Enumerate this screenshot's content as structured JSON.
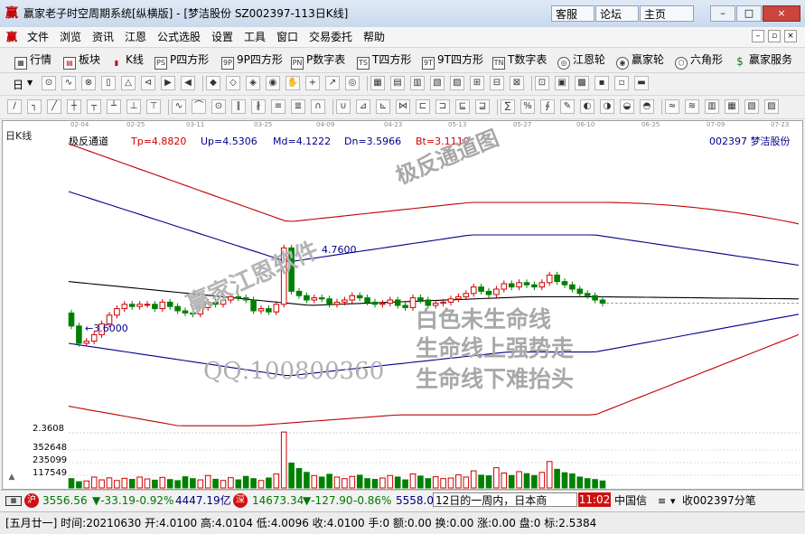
{
  "window": {
    "app_icon": "赢",
    "title": "赢家老子时空周期系统[纵横版] - [梦洁股份   SZ002397-113日K线]",
    "links": [
      "客服",
      "论坛",
      "主页"
    ],
    "controls": [
      "–",
      "□",
      "×"
    ]
  },
  "menu": {
    "logo": "赢",
    "items": [
      "文件",
      "浏览",
      "资讯",
      "江恩",
      "公式选股",
      "设置",
      "工具",
      "窗口",
      "交易委托",
      "帮助"
    ],
    "mdi_buttons": [
      "–",
      "▫",
      "×"
    ]
  },
  "functions": {
    "items": [
      {
        "label": "行情",
        "icon": "grid-icon"
      },
      {
        "label": "板块",
        "icon": "plate-icon"
      },
      {
        "label": "K线",
        "icon": "kline-icon"
      },
      {
        "label": "P四方形",
        "icon": "ps-icon",
        "badge": "PS"
      },
      {
        "label": "9P四方形",
        "icon": "9p-icon",
        "badge": "9P"
      },
      {
        "label": "P数字表",
        "icon": "pn-icon",
        "badge": "PN"
      },
      {
        "label": "T四方形",
        "icon": "ts-icon",
        "badge": "TS"
      },
      {
        "label": "9T四方形",
        "icon": "9t-icon",
        "badge": "9T"
      },
      {
        "label": "T数字表",
        "icon": "tn-icon",
        "badge": "TN"
      },
      {
        "label": "江恩轮",
        "icon": "gann-wheel-icon"
      },
      {
        "label": "赢家轮",
        "icon": "winner-wheel-icon"
      },
      {
        "label": "六角形",
        "icon": "hexagon-icon"
      },
      {
        "label": "赢家服务",
        "icon": "service-icon"
      }
    ]
  },
  "toolbar_row1": {
    "first_label": "日",
    "icon_count": 30
  },
  "toolbar_row2": {
    "icon_count": 38
  },
  "chart": {
    "period_label": "日K线",
    "date_ticks": [
      "02-04",
      "02-25",
      "03-11",
      "03-25",
      "04-09",
      "04-23",
      "05-13",
      "05-27",
      "06-10",
      "06-25",
      "07-09",
      "07-23"
    ],
    "indicator": {
      "name": "极反通道",
      "tp": "Tp=4.8820",
      "up": "Up=4.5306",
      "md": "Md=4.1222",
      "dn": "Dn=3.5966",
      "bt": "Bt=3.1110"
    },
    "stock_label": "002397 梦洁股份",
    "high_label": "4.7600",
    "low_label": "3.6000",
    "volume_ticks": [
      "2.3608",
      "352648",
      "235099",
      "117549"
    ],
    "colors": {
      "up": "#d00000",
      "down": "#008000",
      "band_outer": "#c00000",
      "band_inner": "#00008b",
      "mid": "#000000"
    }
  },
  "chart_data": {
    "type": "candlestick",
    "title": "极反通道",
    "x": [
      "02-04",
      "02-25",
      "03-11",
      "03-25",
      "04-09",
      "04-23",
      "05-13",
      "05-27",
      "06-10"
    ],
    "series": [
      {
        "name": "Tp",
        "last": 4.882
      },
      {
        "name": "Up",
        "last": 4.5306
      },
      {
        "name": "Md",
        "last": 4.1222
      },
      {
        "name": "Dn",
        "last": 3.5966
      },
      {
        "name": "Bt",
        "last": 3.111
      }
    ],
    "period_high": 4.76,
    "period_low": 3.6,
    "closes": [
      3.86,
      3.7,
      3.72,
      3.78,
      3.88,
      3.96,
      4.02,
      4.06,
      4.04,
      4.06,
      4.06,
      4.02,
      4.08,
      4.04,
      4.0,
      3.98,
      3.97,
      4.03,
      4.08,
      4.06,
      4.1,
      4.13,
      4.12,
      4.1,
      4.0,
      4.02,
      3.99,
      4.06,
      4.58,
      4.18,
      4.14,
      4.1,
      4.12,
      4.11,
      4.06,
      4.08,
      4.1,
      4.14,
      4.12,
      4.08,
      4.06,
      4.07,
      4.1,
      4.05,
      4.03,
      4.12,
      4.1,
      4.05,
      4.07,
      4.08,
      4.11,
      4.13,
      4.16,
      4.22,
      4.18,
      4.15,
      4.2,
      4.25,
      4.22,
      4.26,
      4.24,
      4.22,
      4.26,
      4.33,
      4.27,
      4.24,
      4.2,
      4.16,
      4.14,
      4.1,
      4.07
    ],
    "volume_ylim": [
      0,
      352648
    ],
    "volume_max": 360800,
    "volumes": [
      60000,
      40000,
      45000,
      70000,
      52000,
      65000,
      48000,
      62000,
      55000,
      70000,
      58000,
      50000,
      68000,
      54000,
      47000,
      72000,
      60000,
      52000,
      80000,
      56000,
      48000,
      66000,
      52000,
      74000,
      60000,
      48000,
      64000,
      90000,
      360000,
      160000,
      125000,
      100000,
      80000,
      70000,
      88000,
      70000,
      60000,
      74000,
      82000,
      60000,
      55000,
      64000,
      80000,
      70000,
      52000,
      90000,
      76000,
      60000,
      72000,
      60000,
      64000,
      84000,
      70000,
      110000,
      82000,
      78000,
      130000,
      96000,
      80000,
      105000,
      92000,
      80000,
      100000,
      170000,
      120000,
      98000,
      90000,
      70000,
      60000,
      54000,
      45000
    ]
  },
  "watermarks": {
    "w1": "极反通道图",
    "w2": "赢家江恩软件",
    "w3": "QQ:100800360",
    "w4": "白色未生命线",
    "w5": "生命线上强势走",
    "w6": "生命线下难抬头"
  },
  "statusbar": {
    "index1_icon": "沪",
    "index1": "3556.56",
    "index1_chg": "▼-33.19",
    "index1_pct": "-0.92%",
    "index1_amt": "4447.19亿",
    "index2_icon": "深",
    "index2": "14673.34",
    "index2_chg": "▼-127.90",
    "index2_pct": "-0.86%",
    "index2_amt": "5558.0",
    "news": "12日的一周内，日本商",
    "time": "11:02",
    "tail_label": "中国信",
    "watch": "收002397分笔"
  },
  "bottom": {
    "quote": "[五月廿一] 时间:20210630 开:4.0100 高:4.0104 低:4.0096 收:4.0100 手:0 额:0.00 换:0.00 涨:0.00 盘:0 标:2.5384"
  }
}
